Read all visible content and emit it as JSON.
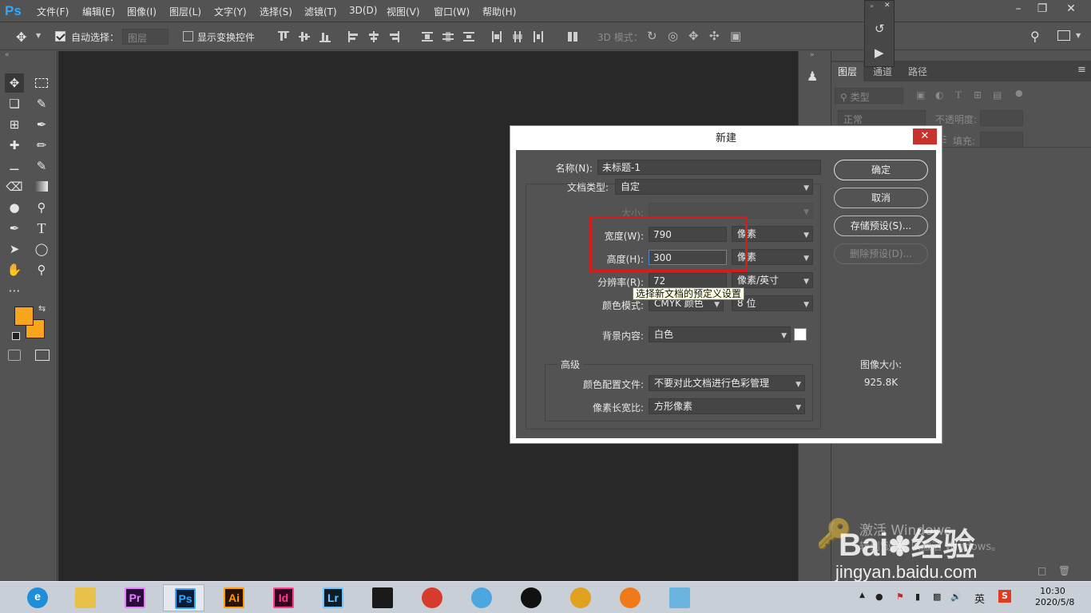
{
  "app": {
    "logo": "Ps",
    "menus": [
      "文件(F)",
      "编辑(E)",
      "图像(I)",
      "图层(L)",
      "文字(Y)",
      "选择(S)",
      "滤镜(T)",
      "3D(D)",
      "视图(V)",
      "窗口(W)",
      "帮助(H)"
    ]
  },
  "options_bar": {
    "auto_select_label": "自动选择：",
    "auto_select_value": "图层",
    "auto_select_checked": true,
    "show_transform_label": "显示变换控件",
    "show_transform_checked": false,
    "mode_3d_label": "3D 模式："
  },
  "layers_panel": {
    "tabs": [
      "图层",
      "通道",
      "路径"
    ],
    "kind_filter": "类型",
    "blend_mode": "正常",
    "opacity_label": "不透明度:",
    "fill_label": "填充:"
  },
  "dialog": {
    "title": "新建",
    "name_label": "名称(N):",
    "name_value": "未标题-1",
    "doc_type_label": "文档类型:",
    "doc_type_value": "自定",
    "size_label": "大小:",
    "width_label": "宽度(W):",
    "width_value": "790",
    "width_unit": "像素",
    "height_label": "高度(H):",
    "height_value": "300",
    "height_unit": "像素",
    "resolution_label": "分辨率(R):",
    "resolution_value": "72",
    "resolution_unit": "像素/英寸",
    "color_mode_label": "颜色模式:",
    "color_mode_value": "CMYK 颜色",
    "bit_depth_value": "8 位",
    "bg_label": "背景内容:",
    "bg_value": "白色",
    "bg_swatch": "#ffffff",
    "advanced_label": "高级",
    "color_profile_label": "颜色配置文件:",
    "color_profile_value": "不要对此文档进行色彩管理",
    "pixel_aspect_label": "像素长宽比:",
    "pixel_aspect_value": "方形像素",
    "ok_label": "确定",
    "cancel_label": "取消",
    "save_preset_label": "存储预设(S)...",
    "delete_preset_label": "删除预设(D)...",
    "image_size_label": "图像大小:",
    "image_size_value": "925.8K",
    "tooltip": "选择新文档的预定义设置"
  },
  "colors": {
    "foreground": "#f7a51d",
    "background": "#f7a51d",
    "highlight": "#d61b1b"
  },
  "watermark": {
    "activate_line1": "激活 Windows",
    "activate_line2": "转到\"设置\"以激活 Windows。",
    "baidu": "Bai",
    "baidu2": "经验",
    "url": "jingyan.baidu.com"
  },
  "taskbar": {
    "apps": [
      {
        "name": "Edge",
        "label": "e",
        "color": "#1f8ed8"
      },
      {
        "name": "Explorer",
        "label": "",
        "color": "#e8c14b"
      },
      {
        "name": "Premiere",
        "label": "Pr",
        "color": "#2a0a3a"
      },
      {
        "name": "Photoshop",
        "label": "Ps",
        "color": "#0b1b33"
      },
      {
        "name": "Illustrator",
        "label": "Ai",
        "color": "#2b1200"
      },
      {
        "name": "InDesign",
        "label": "Id",
        "color": "#3a0020"
      },
      {
        "name": "Lightroom",
        "label": "Lr",
        "color": "#0a1d2a"
      },
      {
        "name": "Video",
        "label": "",
        "color": "#1a1a1a"
      },
      {
        "name": "Umbrella",
        "label": "",
        "color": "#d63b2b"
      },
      {
        "name": "Bird",
        "label": "",
        "color": "#4aa7e0"
      },
      {
        "name": "QQ",
        "label": "",
        "color": "#111111"
      },
      {
        "name": "Chrome",
        "label": "",
        "color": "#e0a020"
      },
      {
        "name": "Firefox",
        "label": "",
        "color": "#f07a1a"
      },
      {
        "name": "Notepad",
        "label": "",
        "color": "#6bb4e0"
      }
    ],
    "ime": "英",
    "time": "10:30",
    "date": "2020/5/8"
  }
}
